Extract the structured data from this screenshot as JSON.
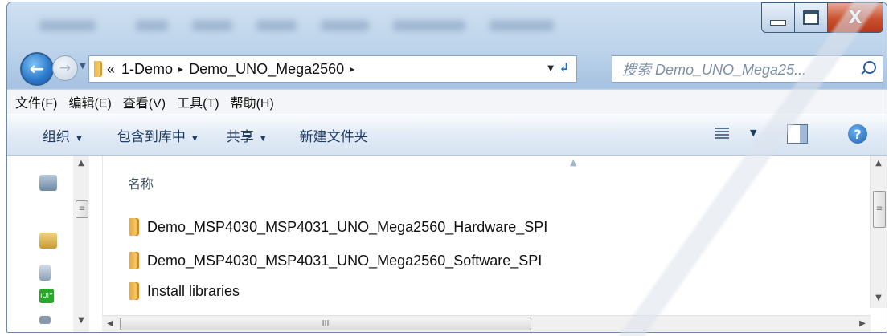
{
  "window": {
    "controls": {
      "minimize_icon": "minimize-icon",
      "maximize_icon": "maximize-icon",
      "close_label": "X"
    }
  },
  "nav": {
    "back_icon": "back-arrow-icon",
    "forward_icon": "forward-arrow-icon",
    "breadcrumb_overflow": "«",
    "breadcrumbs": [
      "1-Demo",
      "Demo_UNO_Mega2560"
    ],
    "separator": "▸",
    "search_placeholder": "搜索 Demo_UNO_Mega25..."
  },
  "menubar": {
    "items": [
      "文件(F)",
      "编辑(E)",
      "查看(V)",
      "工具(T)",
      "帮助(H)"
    ]
  },
  "toolbar": {
    "organize": "组织",
    "include_library": "包含到库中",
    "share": "共享",
    "new_folder": "新建文件夹",
    "help_label": "?"
  },
  "file_list": {
    "column_name": "名称",
    "items": [
      "Demo_MSP4030_MSP4031_UNO_Mega2560_Hardware_SPI",
      "Demo_MSP4030_MSP4031_UNO_Mega2560_Software_SPI",
      "Install libraries"
    ]
  },
  "scrollbars": {
    "thumb_grip": "≡",
    "hthumb_grip": "III"
  }
}
